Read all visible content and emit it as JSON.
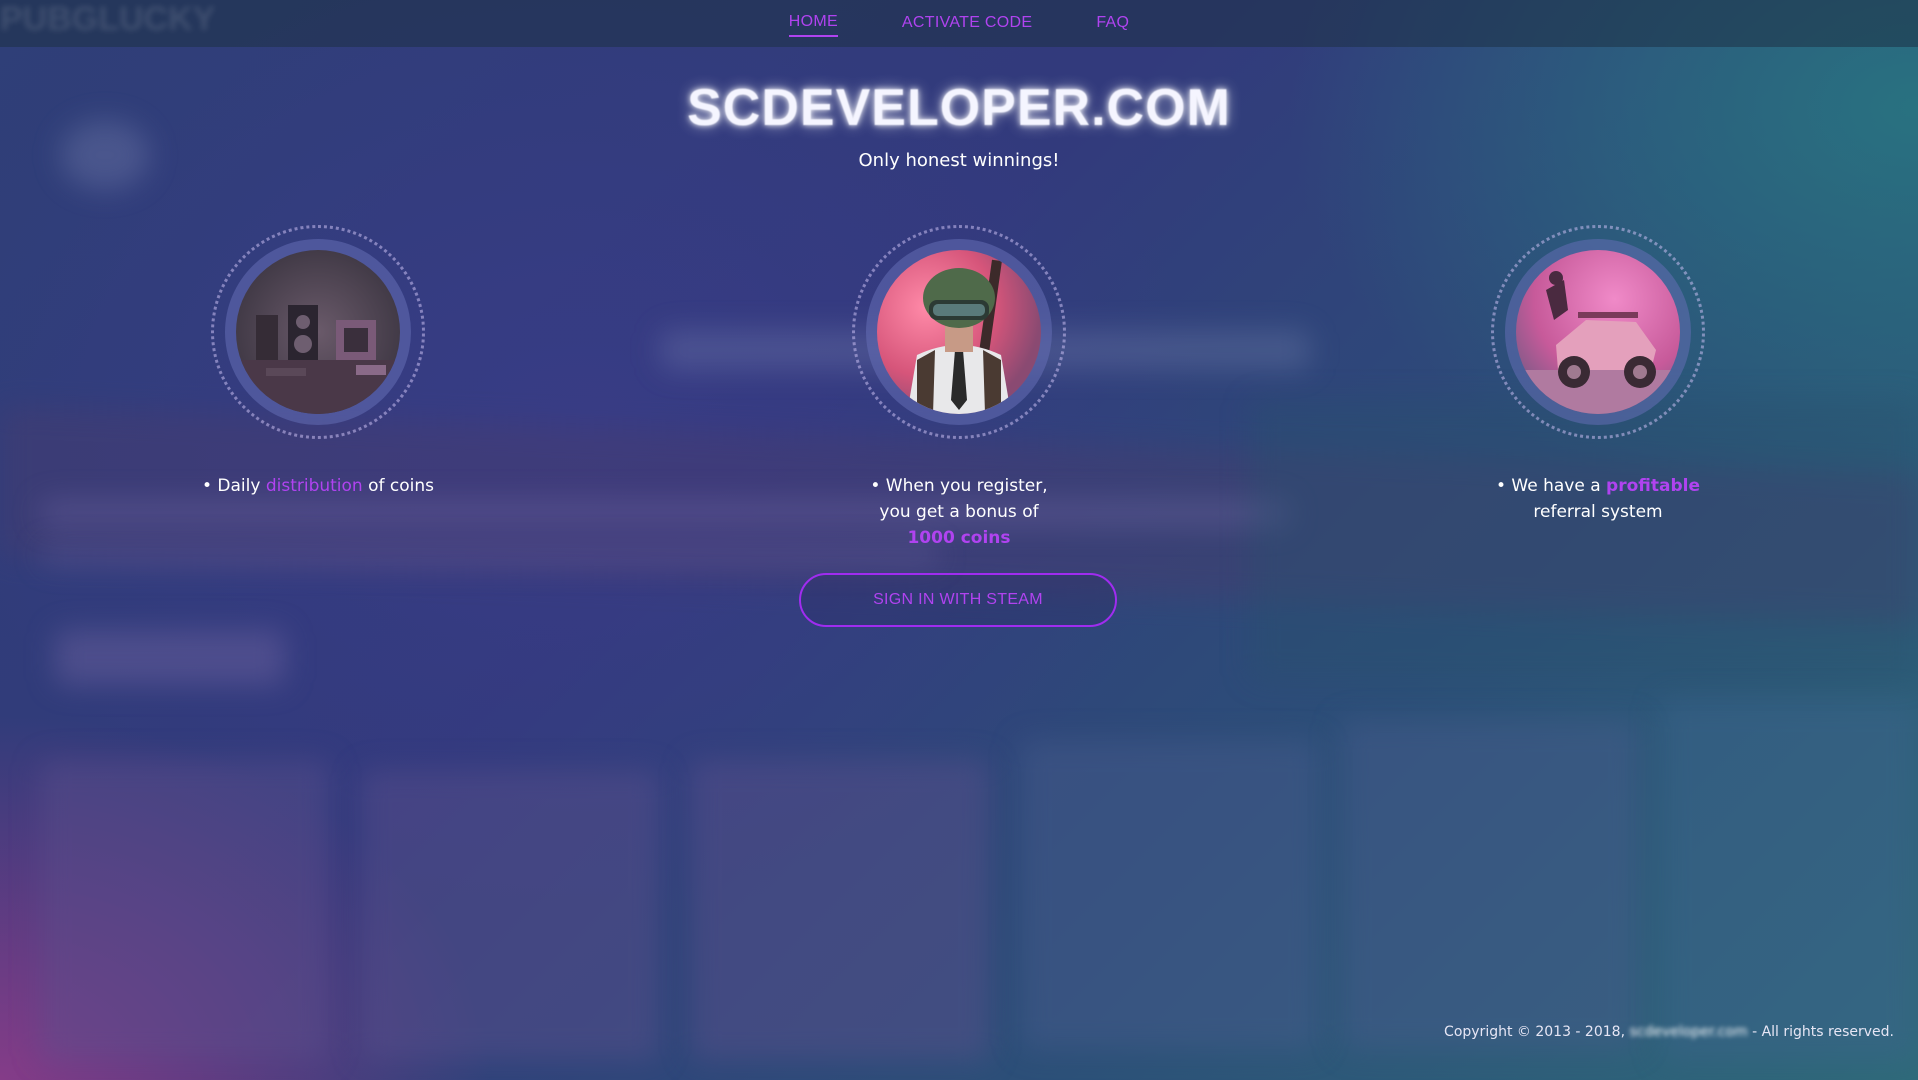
{
  "nav": {
    "ghost_logo": "PUBGLUCKY",
    "items": [
      {
        "label": "HOME",
        "active": true
      },
      {
        "label": "ACTIVATE CODE",
        "active": false
      },
      {
        "label": "FAQ",
        "active": false
      }
    ]
  },
  "hero": {
    "title": "SCDEVELOPER.COM",
    "tagline": "Only honest winnings!"
  },
  "features": [
    {
      "image": "speaker-room-picture",
      "parts": [
        "• Daily ",
        "distribution",
        " of coins"
      ]
    },
    {
      "image": "soldier-helmet-picture",
      "parts": [
        "• When you register,",
        "you get a bonus of",
        "1000 coins"
      ]
    },
    {
      "image": "buggy-vehicle-picture",
      "parts": [
        "• We have a ",
        "profitable",
        "referral system"
      ]
    }
  ],
  "cta": {
    "sign_in_label": "SIGN IN WITH STEAM"
  },
  "footer": {
    "prefix": "Copyright © 2013 - 2018, ",
    "domain": "scdeveloper.com",
    "suffix": " - All rights reserved."
  },
  "colors": {
    "accent": "#b043f0",
    "text": "#ffffff"
  }
}
